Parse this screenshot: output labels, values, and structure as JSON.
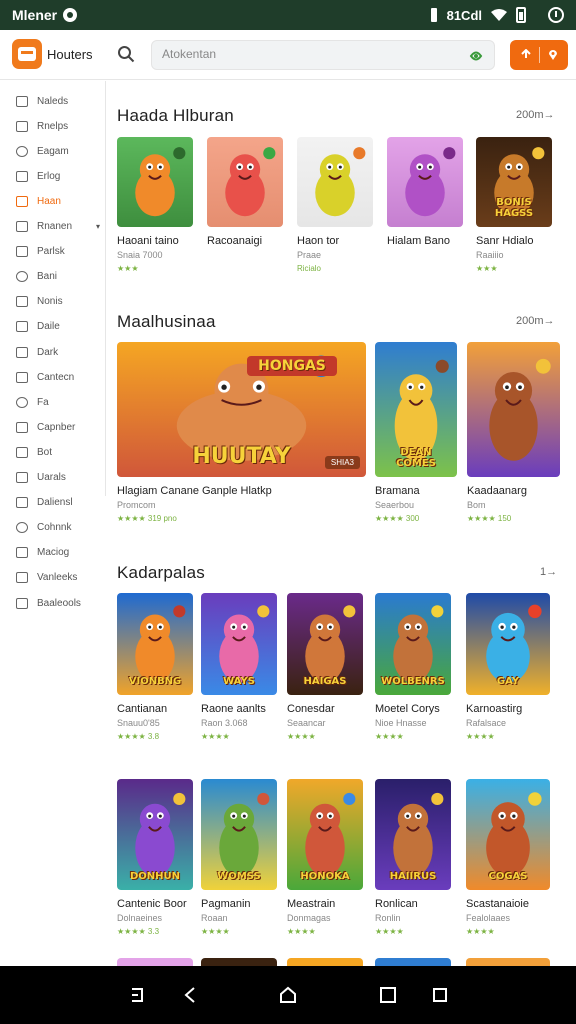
{
  "status_bar": {
    "title": "Mlener",
    "time": "81Cdl"
  },
  "header": {
    "brand": "Houters",
    "search_placeholder": "Atokentan"
  },
  "sidebar": {
    "items": [
      {
        "label": "Naleds",
        "icon": "home-icon"
      },
      {
        "label": "Rnelps",
        "icon": "list-icon"
      },
      {
        "label": "Eagam",
        "icon": "gamepad-icon"
      },
      {
        "label": "Erlog",
        "icon": "book-icon"
      },
      {
        "label": "Haan",
        "icon": "store-icon",
        "active": true
      },
      {
        "label": "Rnanen",
        "icon": "box-icon",
        "caret": "▾"
      },
      {
        "label": "Parlsk",
        "icon": "chart-icon"
      },
      {
        "label": "Bani",
        "icon": "stack-icon"
      },
      {
        "label": "Nonis",
        "icon": "grid-icon"
      },
      {
        "label": "Daile",
        "icon": "calendar-icon"
      },
      {
        "label": "Dark",
        "icon": "moon-icon"
      },
      {
        "label": "Cantecn",
        "icon": "search-icon"
      },
      {
        "label": "Fa",
        "icon": "bird-icon"
      },
      {
        "label": "Capnber",
        "icon": "folder-icon"
      },
      {
        "label": "Bot",
        "icon": "bot-icon"
      },
      {
        "label": "Uarals",
        "icon": "download-icon"
      },
      {
        "label": "Daliensl",
        "icon": "pen-icon"
      },
      {
        "label": "Cohnnk",
        "icon": "clipboard-icon"
      },
      {
        "label": "Maciog",
        "icon": "mail-icon"
      },
      {
        "label": "Vanleeks",
        "icon": "link-icon"
      },
      {
        "label": "Baaleools",
        "icon": "tag-icon"
      }
    ]
  },
  "sections": [
    {
      "title": "Haada Hlburan",
      "more": "200m→",
      "items": [
        {
          "name": "Haoani taino",
          "sub": "Snaia 7000",
          "rating": "★★★"
        },
        {
          "name": "Racoanaigi",
          "sub": "",
          "rating": ""
        },
        {
          "name": "Haon tor",
          "sub": "Praae",
          "rating": "Ricialo"
        },
        {
          "name": "Hialam Bano",
          "sub": "",
          "rating": ""
        },
        {
          "name": "Sanr Hdialo",
          "sub": "Raaiiio",
          "rating": "★★★",
          "art_text": "BONIS HAGSS"
        }
      ]
    },
    {
      "title": "Maalhusinaa",
      "more": "200m→",
      "items": [
        {
          "name": "Hlagiam Canane Ganple Hlatkp",
          "sub": "Promcom",
          "rating": "★★★★ 319 pno",
          "art_text": "HUUTAY",
          "art_text2": "HONGAS",
          "badge": "SHIA3"
        },
        {
          "name": "Bramana",
          "sub": "Seaerbou",
          "rating": "★★★★ 300",
          "art_text": "DEAN COMES"
        },
        {
          "name": "Kaadaanarg",
          "sub": "Bom",
          "rating": "★★★★ 150"
        }
      ]
    },
    {
      "title": "Kadarpalas",
      "more": "1→",
      "rows": [
        [
          {
            "name": "Cantianan",
            "sub": "Snauu0'85",
            "rating": "★★★★ 3.8",
            "art_text": "VIONBNG"
          },
          {
            "name": "Raone aanlts",
            "sub": "Raon 3.068",
            "rating": "★★★★",
            "art_text": "WAYS"
          },
          {
            "name": "Conesdar",
            "sub": "Seaancar",
            "rating": "★★★★",
            "art_text": "HAIGAS"
          },
          {
            "name": "Moetel Corys",
            "sub": "Nioe Hnasse",
            "rating": "★★★★",
            "art_text": "WOLBENRS"
          },
          {
            "name": "Karnoastirg",
            "sub": "Rafalsace",
            "rating": "★★★★",
            "art_text": "GAY"
          }
        ],
        [
          {
            "name": "Cantenic Boor",
            "sub": "Dolnaeines",
            "rating": "★★★★ 3.3",
            "art_text": "DONHUN"
          },
          {
            "name": "Pagmanin",
            "sub": "Roaan",
            "rating": "★★★★",
            "art_text": "WOMSS"
          },
          {
            "name": "Meastrain",
            "sub": "Donmagas",
            "rating": "★★★★",
            "art_text": "HONOKA"
          },
          {
            "name": "Ronlican",
            "sub": "Ronlin",
            "rating": "★★★★",
            "art_text": "HAIIRUS"
          },
          {
            "name": "Scastanaioie",
            "sub": "Fealolaaes",
            "rating": "★★★★",
            "art_text": "COGAS"
          }
        ]
      ]
    }
  ],
  "colors": {
    "accent": "#f06a0f",
    "status_bar": "#1f3d2a",
    "rating_green": "#6aa84f",
    "rating_gold": "#e0a800"
  }
}
